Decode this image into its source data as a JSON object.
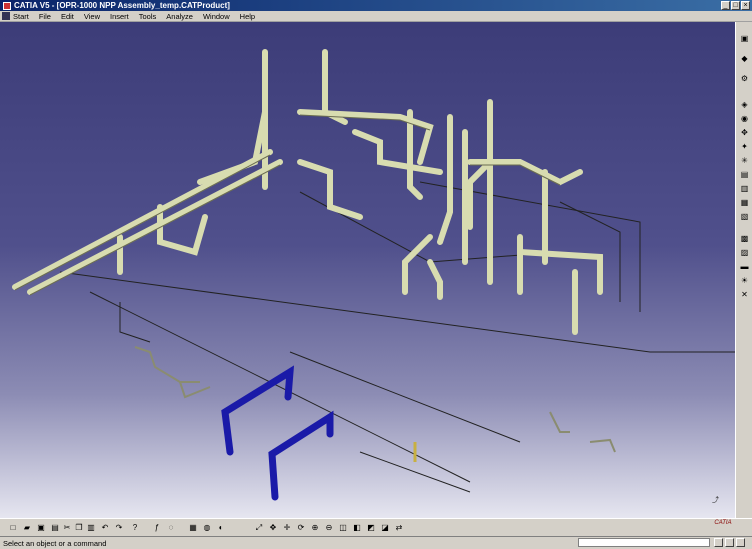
{
  "window": {
    "title": "CATIA V5 - [OPR-1000 NPP Assembly_temp.CATProduct]"
  },
  "menu": {
    "items": [
      {
        "label": "Start"
      },
      {
        "label": "File"
      },
      {
        "label": "Edit"
      },
      {
        "label": "View"
      },
      {
        "label": "Insert"
      },
      {
        "label": "Tools"
      },
      {
        "label": "Analyze"
      },
      {
        "label": "Window"
      },
      {
        "label": "Help"
      }
    ]
  },
  "status": {
    "message": "Select an object or a command"
  },
  "logo": {
    "text": "CATIA"
  },
  "right_toolbar": {
    "icons": [
      "product-icon",
      "assembly-icon",
      "constraint-icon",
      "fix-icon",
      "snap-icon",
      "move-icon",
      "explode-icon",
      "clash-icon",
      "section-icon",
      "measure-icon",
      "catalog-icon",
      "bom-icon",
      "lightbulb-icon",
      "delete-icon"
    ]
  },
  "bottom_toolbar": {
    "icons": [
      "new-icon",
      "open-icon",
      "save-icon",
      "print-icon",
      "cut-icon",
      "copy-icon",
      "paste-icon",
      "undo-icon",
      "redo-icon",
      "whats-this-icon",
      "formula-icon",
      "comment-icon",
      "sketch-icon",
      "catalog-icon",
      "material-icon",
      "fly-icon",
      "fit-all-icon",
      "pan-icon",
      "rotate-icon",
      "zoom-in-icon",
      "zoom-out-icon",
      "normal-view-icon",
      "iso-view-icon",
      "shading-icon",
      "hide-show-icon",
      "swap-icon"
    ]
  },
  "colors": {
    "pipe": "#d8dcb0",
    "highlight": "#1a1aa8",
    "viewport_top": "#3c3c78",
    "viewport_bottom": "#e6e6f0"
  }
}
